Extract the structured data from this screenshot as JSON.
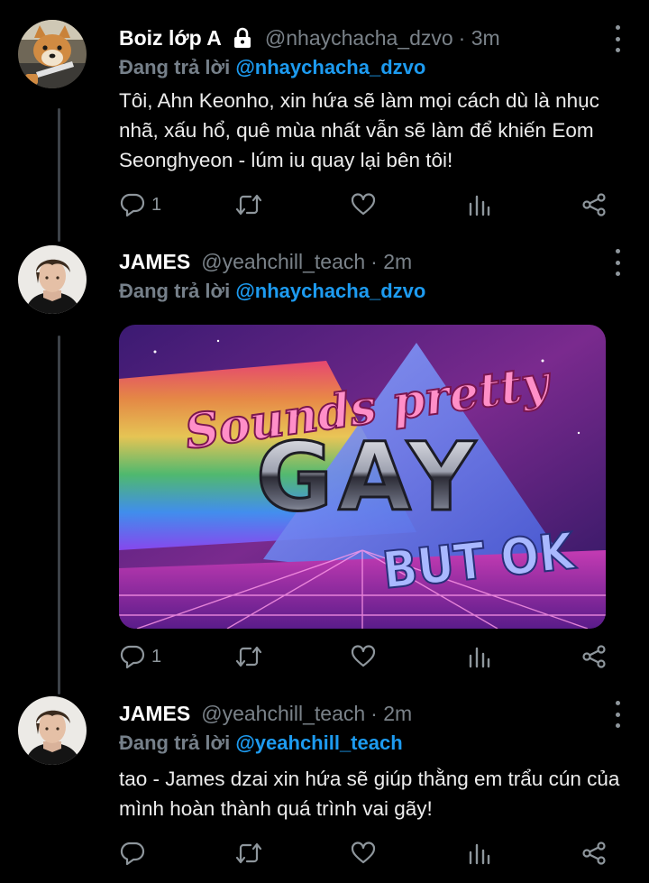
{
  "colors": {
    "background": "#000000",
    "name": "#ffffff",
    "handle": "#7a8289",
    "mention": "#1d9bf0",
    "icon": "#8e969c",
    "thread_line": "#3d4248"
  },
  "tweets": [
    {
      "name": "Boiz lớp A",
      "protected": true,
      "handle": "@nhaychacha_dzvo",
      "time": "· 3m",
      "replying_prefix": "Đang trả lời",
      "replying_to": "@nhaychacha_dzvo",
      "text": "Tôi, Ahn Keonho, xin hứa sẽ làm mọi cách dù là nhục nhã, xấu hổ, quê mùa nhất vẫn sẽ làm để khiến Eom Seonghyeon - lúm iu quay lại bên tôi!",
      "reply_count": "1",
      "avatar_icon": "shiba-dog-avatar"
    },
    {
      "name": "JAMES",
      "handle": "@yeahchill_teach",
      "time": "· 2m",
      "replying_prefix": "Đang trả lời",
      "replying_to": "@nhaychacha_dzvo",
      "media": {
        "line1": "Sounds pretty",
        "line2": "GAY",
        "line3": "BUT OK"
      },
      "reply_count": "1",
      "avatar_icon": "person-avatar"
    },
    {
      "name": "JAMES",
      "handle": "@yeahchill_teach",
      "time": "· 2m",
      "replying_prefix": "Đang trả lời",
      "replying_to": "@yeahchill_teach",
      "text": "tao - James dzai xin hứa sẽ giúp thằng em trẩu cún của mình hoàn thành quá trình vai gãy!",
      "reply_count": "",
      "avatar_icon": "person-avatar"
    }
  ],
  "action_icons": [
    "reply-icon",
    "retweet-icon",
    "like-icon",
    "analytics-icon",
    "share-icon"
  ]
}
